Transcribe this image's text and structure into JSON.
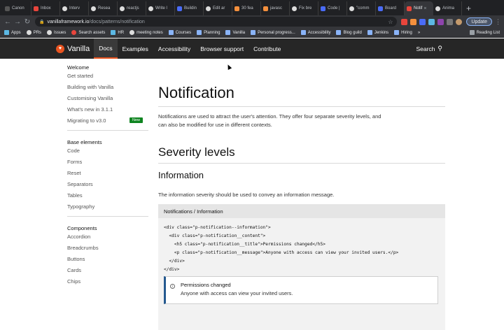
{
  "browser": {
    "tabs": [
      {
        "label": "Canon",
        "icon": "dark"
      },
      {
        "label": "Inbox",
        "icon": "red"
      },
      {
        "label": "Interv",
        "icon": "gh"
      },
      {
        "label": "Resea",
        "icon": "gh"
      },
      {
        "label": "reactjs",
        "icon": "gh"
      },
      {
        "label": "Write l",
        "icon": "gh"
      },
      {
        "label": "Buildin",
        "icon": "blue"
      },
      {
        "label": "Edit ar",
        "icon": "gh"
      },
      {
        "label": "30 fea",
        "icon": "orange"
      },
      {
        "label": "javasc",
        "icon": "orange"
      },
      {
        "label": "Fix bre",
        "icon": "gh"
      },
      {
        "label": "Code |",
        "icon": "blue"
      },
      {
        "label": "\"comm",
        "icon": "gh"
      },
      {
        "label": "Board",
        "icon": "blue"
      },
      {
        "label": "Notif",
        "icon": "red"
      },
      {
        "label": "Anima",
        "icon": "gh"
      }
    ],
    "active_tab_index": 14,
    "new_tab": "+",
    "url_host": "vanillaframework.io",
    "url_path": "/docs/patterns/notification",
    "update_label": "Update",
    "bookmarks": [
      {
        "label": "Apps",
        "icon": "mint"
      },
      {
        "label": "PRs",
        "icon": "gh"
      },
      {
        "label": "Issues",
        "icon": "gh"
      },
      {
        "label": "Search assets",
        "icon": "red"
      },
      {
        "label": "HR",
        "icon": "mint"
      },
      {
        "label": "meeting notes",
        "icon": "gh"
      },
      {
        "label": "Courses",
        "icon": "folder"
      },
      {
        "label": "Planning",
        "icon": "folder"
      },
      {
        "label": "Vanilla",
        "icon": "folder"
      },
      {
        "label": "Personal progress...",
        "icon": "folder"
      },
      {
        "label": "Accessibility",
        "icon": "folder"
      },
      {
        "label": "Blog guild",
        "icon": "folder"
      },
      {
        "label": "Jenkins",
        "icon": "folder"
      },
      {
        "label": "Hiring",
        "icon": "folder"
      }
    ],
    "reading_list": "Reading List",
    "overflow": "»"
  },
  "site": {
    "brand": "Vanilla",
    "nav": [
      "Docs",
      "Examples",
      "Accessibility",
      "Browser support",
      "Contribute"
    ],
    "active_nav": "Docs",
    "search_label": "Search"
  },
  "sidebar": {
    "groups": [
      {
        "heading": "Welcome",
        "items": [
          "Get started",
          "Building with Vanilla",
          "Customising Vanilla",
          "What's new in 3.1.1",
          "Migrating to v3.0"
        ]
      },
      {
        "heading": "Base elements",
        "items": [
          "Code",
          "Forms",
          "Reset",
          "Separators",
          "Tables",
          "Typography"
        ]
      },
      {
        "heading": "Components",
        "items": [
          "Accordion",
          "Breadcrumbs",
          "Buttons",
          "Cards",
          "Chips"
        ]
      }
    ],
    "new_badge": "New"
  },
  "main": {
    "title": "Notification",
    "intro": "Notifications are used to attract the user's attention. They offer four separate severity levels, and can also be modified for use in different contexts.",
    "section_title": "Severity levels",
    "subsection_title": "Information",
    "lead": "The information severity should be used to convey an information message.",
    "example": {
      "header": "Notifications / Information",
      "code_lines": [
        "<div class=\"p-notification--information\">",
        "  <div class=\"p-notification__content\">",
        "    <h5 class=\"p-notification__title\">Permissions changed</h5>",
        "    <p class=\"p-notification__message\">Anyone with access can view your invited users.</p>",
        "  </div>",
        "</div>"
      ],
      "demo_title": "Permissions changed",
      "demo_message": "Anyone with access can view your invited users."
    }
  },
  "colors": {
    "brand_orange": "#e95420",
    "badge_green": "#0e8420",
    "info_border": "#24598f"
  }
}
